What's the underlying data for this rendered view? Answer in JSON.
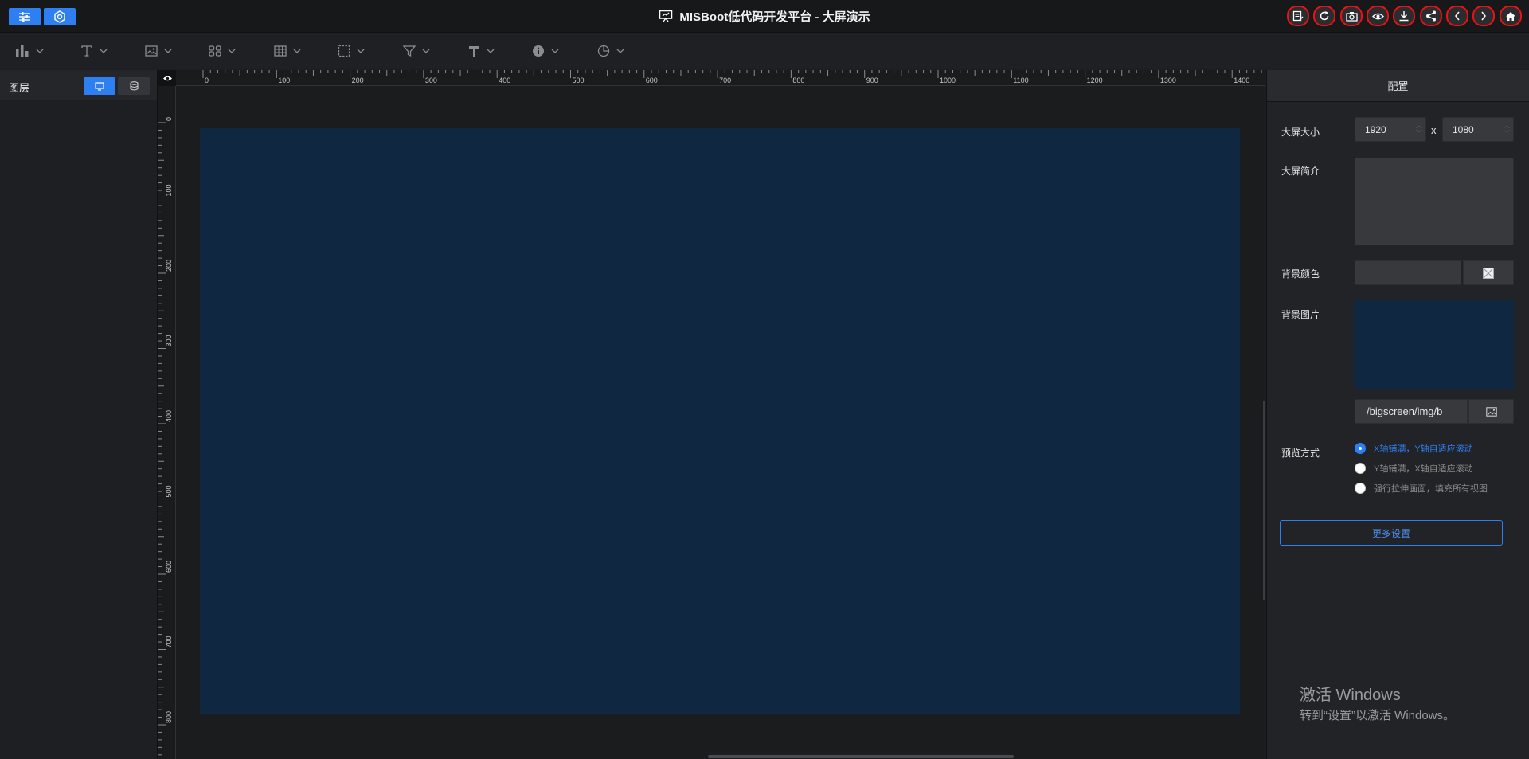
{
  "header": {
    "title": "MISBoot低代码开发平台 - 大屏演示",
    "left_buttons": [
      "sliders-icon",
      "gear-icon"
    ],
    "right_buttons": [
      {
        "icon": "edit-doc-icon",
        "num": "1"
      },
      {
        "icon": "refresh-icon",
        "num": "2"
      },
      {
        "icon": "camera-icon",
        "num": "3"
      },
      {
        "icon": "eye-icon",
        "num": "4"
      },
      {
        "icon": "download-icon",
        "num": "5"
      },
      {
        "icon": "share-icon",
        "num": "6"
      },
      {
        "icon": "chevron-left-icon",
        "num": "7"
      },
      {
        "icon": "chevron-right-icon",
        "num": "8"
      },
      {
        "icon": "home-icon",
        "num": "9"
      }
    ]
  },
  "toolbar": {
    "tools": [
      "bar-chart-icon",
      "text-icon",
      "image-icon",
      "grid-icon",
      "table-icon",
      "select-box-icon",
      "filter-icon",
      "hammer-icon",
      "info-icon",
      "pie-icon"
    ]
  },
  "layers": {
    "title": "图层"
  },
  "rulers": {
    "h_labels": [
      "0",
      "100",
      "200",
      "300",
      "400",
      "500",
      "600",
      "700",
      "800",
      "900",
      "1000",
      "1100",
      "1200",
      "1300",
      "1400"
    ],
    "v_labels": [
      "0",
      "100",
      "200",
      "300",
      "400",
      "500",
      "600",
      "700",
      "800"
    ]
  },
  "config": {
    "title": "配置",
    "size_label": "大屏大小",
    "width": "1920",
    "times": "x",
    "height": "1080",
    "intro_label": "大屏简介",
    "bg_color_label": "背景颜色",
    "bg_image_label": "背景图片",
    "bg_image_path": "/bigscreen/img/b",
    "preview_label": "预览方式",
    "preview_options": [
      "X轴铺满，Y轴自适应滚动",
      "Y轴铺满，X轴自适应滚动",
      "强行拉伸画面，填充所有视图"
    ],
    "more_label": "更多设置",
    "screen_color": "#0f2740",
    "accent": "#2d7ff2"
  },
  "watermark": {
    "line1": "激活 Windows",
    "line2": "转到“设置”以激活 Windows。"
  }
}
